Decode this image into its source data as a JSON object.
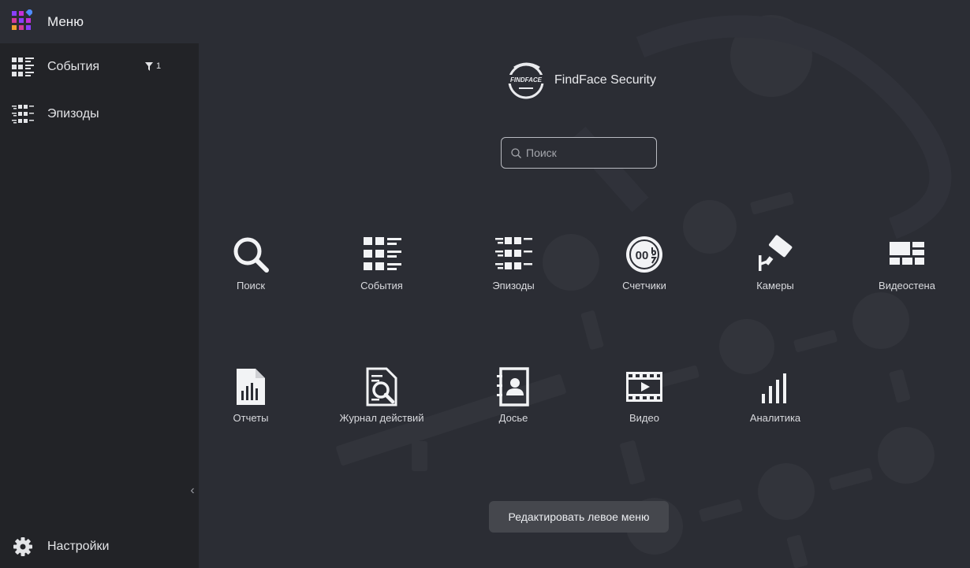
{
  "sidebar": {
    "menu_label": "Меню",
    "items": [
      {
        "label": "События",
        "icon": "events-icon",
        "filter_count": "1"
      },
      {
        "label": "Эпизоды",
        "icon": "episodes-icon"
      }
    ],
    "settings_label": "Настройки",
    "collapse_glyph": "‹"
  },
  "brand": {
    "name": "FindFace Security",
    "logo_text": "FINDFACE"
  },
  "search": {
    "placeholder": "Поиск",
    "value": ""
  },
  "tiles": [
    {
      "label": "Поиск",
      "icon": "search-icon"
    },
    {
      "label": "События",
      "icon": "events-icon"
    },
    {
      "label": "Эпизоды",
      "icon": "episodes-icon"
    },
    {
      "label": "Счетчики",
      "icon": "counter-icon",
      "icon_text": "00"
    },
    {
      "label": "Камеры",
      "icon": "camera-icon"
    },
    {
      "label": "Видеостена",
      "icon": "videowall-icon"
    },
    {
      "label": "Отчеты",
      "icon": "report-icon"
    },
    {
      "label": "Журнал действий",
      "icon": "audit-log-icon"
    },
    {
      "label": "Досье",
      "icon": "dossier-icon"
    },
    {
      "label": "Видео",
      "icon": "video-icon"
    },
    {
      "label": "Аналитика",
      "icon": "analytics-icon"
    }
  ],
  "edit_button": "Редактировать левое меню",
  "colors": {
    "background": "#2b2d34",
    "sidebar": "#222327",
    "accent_purple": "#8a3ffc",
    "accent_magenta": "#d12fd8",
    "accent_orange": "#f0a030",
    "accent_blue": "#4f8cff"
  }
}
